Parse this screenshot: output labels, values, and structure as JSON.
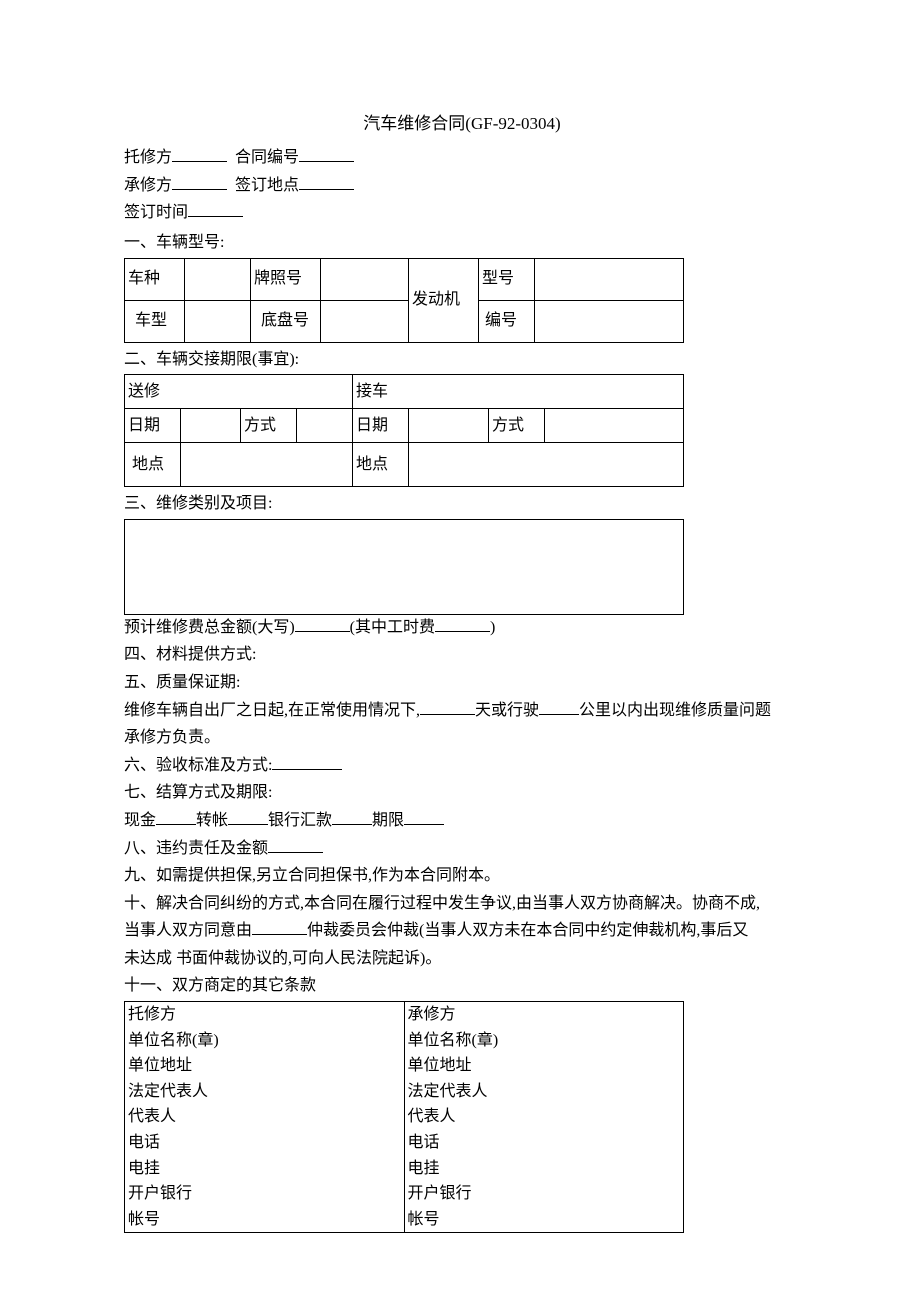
{
  "title": "汽车维修合同(GF-92-0304)",
  "header": {
    "line1a": "托修方",
    "line1b": "合同编号",
    "line2a": "承修方",
    "line2b": "签订地点",
    "line3": "签订时间"
  },
  "sec1": {
    "heading": "一、车辆型号:",
    "r1c1": "车种",
    "r1c2": "牌照号",
    "r1c3": "发动机",
    "r1c4": "型号",
    "r2c1": "车型",
    "r2c2": "底盘号",
    "r2c4": "编号"
  },
  "sec2": {
    "heading": "二、车辆交接期限(事宜):",
    "h1": "送修",
    "h2": "接车",
    "date": "日期",
    "method": "方式",
    "place": "地点"
  },
  "sec3": {
    "heading": "三、维修类别及项目:",
    "total_a": "预计维修费总金额(大写)",
    "total_b": "(其中工时费",
    "total_c": ")"
  },
  "sec4": "四、材料提供方式:",
  "sec5": {
    "heading": "五、质量保证期:",
    "body_a": "维修车辆自出厂之日起,在正常使用情况下,",
    "body_b": "天或行驶",
    "body_c": "公里以内出现维修质量问题",
    "body_d": "承修方负责。"
  },
  "sec6": "六、验收标准及方式:",
  "sec7": {
    "heading": "七、结算方式及期限:",
    "a": "现金",
    "b": "转帐",
    "c": "银行汇款",
    "d": "期限"
  },
  "sec8": "八、违约责任及金额",
  "sec9": "九、如需提供担保,另立合同担保书,作为本合同附本。",
  "sec10": {
    "a": "十、解决合同纠纷的方式,本合同在履行过程中发生争议,由当事人双方协商解决。协商不成,",
    "b": "当事人双方同意由",
    "c": "仲裁委员会仲裁(当事人双方未在本合同中约定伸裁机构,事后又",
    "d": "未达成 书面仲裁协议的,可向人民法院起诉)。"
  },
  "sec11": {
    "heading": "十一、双方商定的其它条款",
    "left_h": "托修方",
    "right_h": "承修方",
    "rows": {
      "r1": "单位名称(章)",
      "r2": "单位地址",
      "r3": "法定代表人",
      "r4": "代表人",
      "r5": "电话",
      "r6": "电挂",
      "r7": "开户银行",
      "r8": "帐号"
    }
  }
}
